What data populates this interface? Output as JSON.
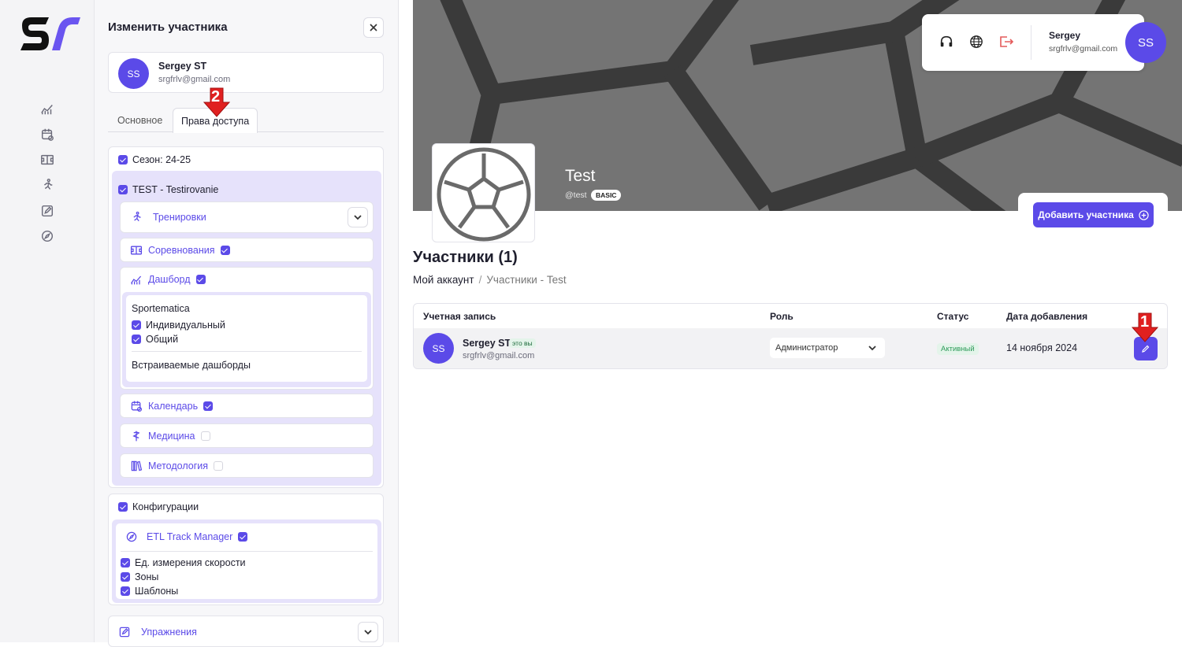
{
  "rail": {
    "logo_text": "ST",
    "icons": [
      "chart-icon",
      "calendar-icon",
      "field-icon",
      "runner-icon",
      "edit-icon",
      "compass-icon"
    ]
  },
  "panel": {
    "title": "Изменить участника",
    "user": {
      "initials": "SS",
      "name": "Sergey ST",
      "email": "srgfrlv@gmail.com"
    },
    "tabs": [
      "Основное",
      "Права доступа"
    ],
    "active_tab": "Права доступа",
    "season": {
      "label": "Сезон: 24-25",
      "checked": true
    },
    "team": {
      "label": "TEST - Testirovanie",
      "checked": true
    },
    "modules": [
      {
        "label": "Тренировки",
        "icon": "runner-icon",
        "checked": null
      },
      {
        "label": "Соревнования",
        "icon": "field-icon",
        "checked": true
      },
      {
        "label": "Дашборд",
        "icon": "chart-icon",
        "checked": true
      },
      {
        "label": "Календарь",
        "icon": "calendar-icon",
        "checked": true
      },
      {
        "label": "Медицина",
        "icon": "medical-icon",
        "checked": false
      },
      {
        "label": "Методология",
        "icon": "books-icon",
        "checked": false
      }
    ],
    "dashboard": {
      "group": "Sportematica",
      "items": [
        {
          "label": "Индивидуальный",
          "checked": true
        },
        {
          "label": "Общий",
          "checked": true
        }
      ],
      "embedded": "Встраиваемые дашборды"
    },
    "config": {
      "label": "Конфигурации",
      "checked": true,
      "etl": {
        "label": "ETL Track Manager",
        "checked": true
      },
      "items": [
        {
          "label": "Ед. измерения скорости",
          "checked": true
        },
        {
          "label": "Зоны",
          "checked": true
        },
        {
          "label": "Шаблоны",
          "checked": true
        }
      ]
    },
    "exercises": {
      "label": "Упражнения"
    }
  },
  "header": {
    "user_name": "Sergey",
    "user_email": "srgfrlv@gmail.com",
    "initials": "SS"
  },
  "team": {
    "name": "Test",
    "handle": "@test",
    "plan": "BASIC"
  },
  "main": {
    "add_button": "Добавить участника",
    "title": "Участники (1)",
    "breadcrumb": [
      "Мой аккаунт",
      "/",
      "Участники - Test"
    ],
    "columns": [
      "Учетная запись",
      "Роль",
      "Статус",
      "Дата добавления"
    ],
    "rows": [
      {
        "initials": "SS",
        "name": "Sergey ST",
        "you_badge": "это вы",
        "email": "srgfrlv@gmail.com",
        "role": "Администратор",
        "status": "Активный",
        "date": "14 ноября 2024"
      }
    ]
  },
  "annotations": {
    "marker1": "1",
    "marker2": "2"
  },
  "colors": {
    "accent": "#5b4ae8",
    "marker": "#e02020",
    "active_status": "#2e9b5a"
  }
}
